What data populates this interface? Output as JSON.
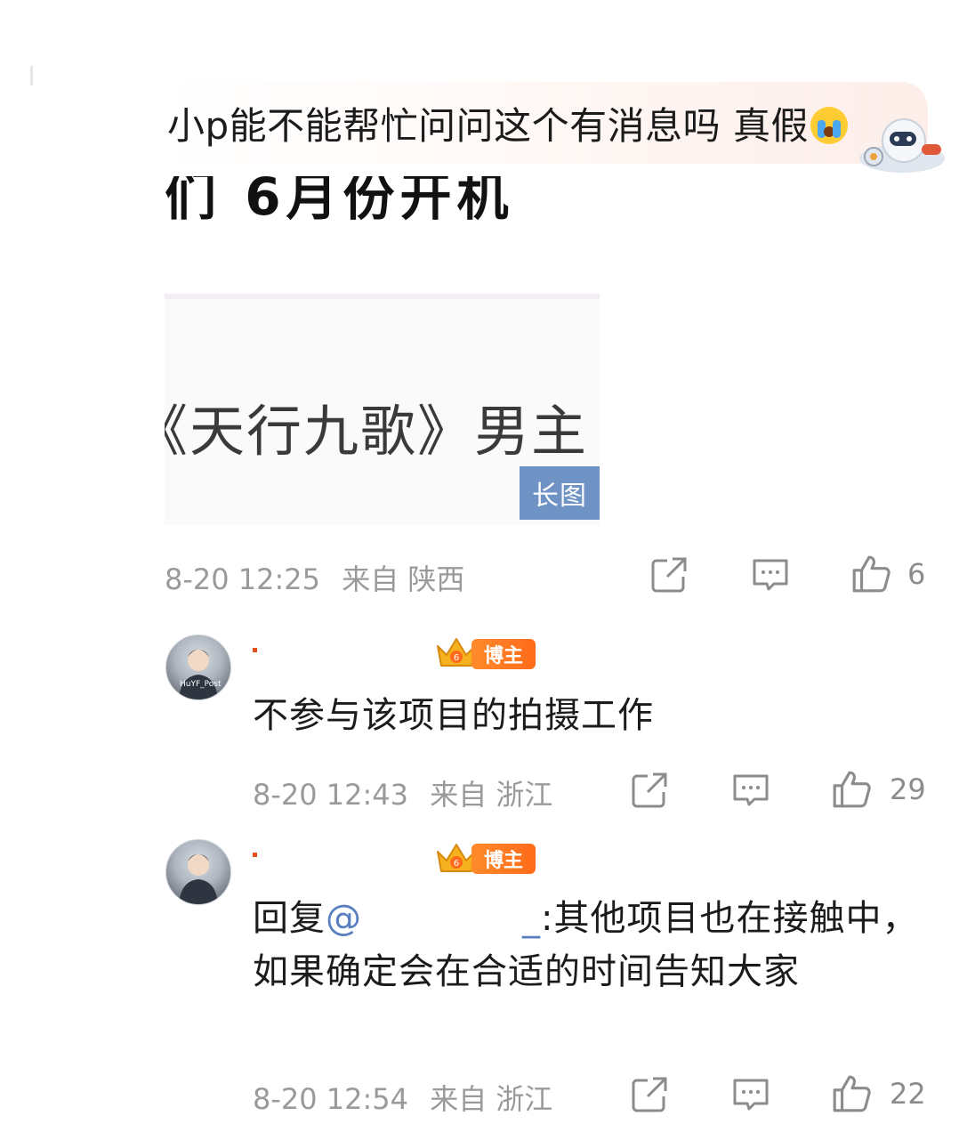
{
  "top_comment": {
    "text": "小p能不能帮忙问问这个有消息吗 真假",
    "emoji_icon": "crying-emoji-icon",
    "pendant_icon": "robot-pendant-icon"
  },
  "image_preview": {
    "fragment_text": "们 6月份开机",
    "card_text": "《天行九歌》男主",
    "badge": "长图"
  },
  "comment_meta": {
    "time": "8-20 12:25",
    "location": "来自 陕西",
    "likes": "6"
  },
  "replies": [
    {
      "tag": "博主",
      "text": "不参与该项目的拍摄工作",
      "time": "8-20 12:43",
      "location": "来自 浙江",
      "likes": "29"
    },
    {
      "tag": "博主",
      "prefix": "回复",
      "mention_start": "@",
      "mention_end": "_",
      "text": ":其他项目也在接触中，如果确定会在合适的时间告知大家",
      "time": "8-20 12:54",
      "location": "来自 浙江",
      "likes": "22"
    }
  ],
  "avatar_caption": "HuYF_Post",
  "icons": {
    "share": "share-icon",
    "comment": "comment-icon",
    "like": "thumbs-up-icon",
    "crown": "crown-level-icon"
  },
  "colors": {
    "tag_orange": "#ff7a20",
    "badge_blue": "#6f93c4",
    "meta_gray": "#9a9a9a"
  }
}
